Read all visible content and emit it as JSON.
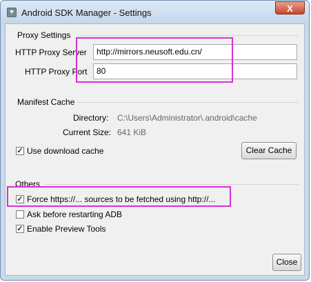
{
  "window": {
    "title": "Android SDK Manager - Settings",
    "close_glyph": "X"
  },
  "proxy": {
    "group_title": "Proxy Settings",
    "server_label": "HTTP Proxy Server",
    "server_value": "http://mirrors.neusoft.edu.cn/",
    "port_label": "HTTP Proxy Port",
    "port_value": "80"
  },
  "manifest": {
    "group_title": "Manifest Cache",
    "directory_label": "Directory:",
    "directory_value": "C:\\Users\\Administrator\\.android\\cache",
    "size_label": "Current Size:",
    "size_value": "641 KiB",
    "use_cache_label": "Use download cache",
    "use_cache_checked": true,
    "clear_cache_label": "Clear Cache"
  },
  "others": {
    "group_title": "Others",
    "force_http_label": "Force https://... sources to be fetched using http://...",
    "force_http_checked": true,
    "ask_restart_label": "Ask before restarting ADB",
    "ask_restart_checked": false,
    "preview_label": "Enable Preview Tools",
    "preview_checked": true
  },
  "close_button_label": "Close",
  "check_glyph": "✓",
  "highlight_color": "#d62fd6"
}
